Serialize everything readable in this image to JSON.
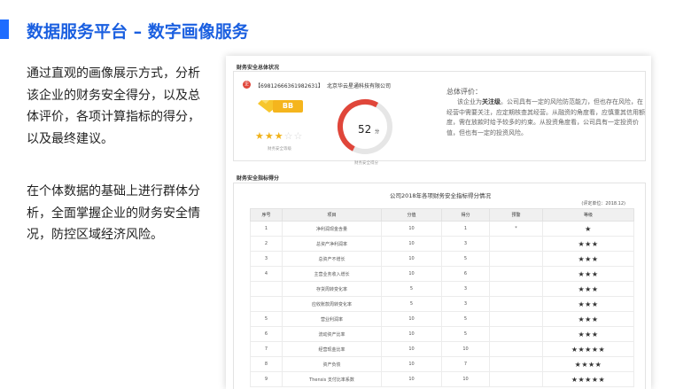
{
  "slide": {
    "title": "数据服务平台 – 数字画像服务",
    "paragraph1": "通过直观的画像展示方式，分析该企业的财务安全得分，以及总体评价，各项计算指标的得分，以及最终建议。",
    "paragraph2": "在个体数据的基础上进行群体分析，全面掌握企业的财务安全情况，防控区域经济风险。"
  },
  "card": {
    "summary_section_title": "财务安全总体状况",
    "company_id": "【69812666361982631】",
    "company_name": "北京华云星通科技有限公司",
    "grade": "BB",
    "stars_on": "★★★",
    "stars_off": "☆☆",
    "rating_caption": "财务安全等级",
    "score": "52",
    "score_unit": "分",
    "score_caption": "财务安全得分",
    "score_fraction": 0.52,
    "eval_title": "总体评价：",
    "eval_prefix": "该企业为",
    "eval_highlight": "关注级",
    "eval_rest": "。公司具有一定的风险防范能力，但也存在风险，在经营中需要关注，应定期核查其经营。从融资的角度看，应慎重其信用额度，需在放款时给予较多的约束。从投资角度看，公司具有一定投资价值，但也有一定的投资风险。",
    "table_section_title": "财务安全指标得分",
    "table_title": "公司2018年各项财务安全指标得分情况",
    "table_unit": "(评定单位：2018.12)",
    "columns": [
      "序号",
      "项目",
      "分值",
      "得分",
      "预警",
      "等级"
    ],
    "rows": [
      {
        "no": "1",
        "item": "净利润现金含量",
        "value": "10",
        "score": "1",
        "warn": "*",
        "level": "★"
      },
      {
        "no": "2",
        "item": "总资产净利润率",
        "value": "10",
        "score": "3",
        "warn": "",
        "level": "★★★"
      },
      {
        "no": "3",
        "item": "总资产不增长",
        "value": "10",
        "score": "5",
        "warn": "",
        "level": "★★★"
      },
      {
        "no": "4",
        "item": "主营业务收入增长",
        "value": "10",
        "score": "6",
        "warn": "",
        "level": "★★★"
      },
      {
        "no": "",
        "item": "存货周转变化率",
        "value": "5",
        "score": "3",
        "warn": "",
        "level": "★★★"
      },
      {
        "no": "",
        "item": "应收账款周转变化率",
        "value": "5",
        "score": "3",
        "warn": "",
        "level": "★★★"
      },
      {
        "no": "5",
        "item": "营业利润率",
        "value": "10",
        "score": "5",
        "warn": "",
        "level": "★★★"
      },
      {
        "no": "6",
        "item": "流动资产比率",
        "value": "10",
        "score": "5",
        "warn": "",
        "level": "★★★"
      },
      {
        "no": "7",
        "item": "经营现金比率",
        "value": "10",
        "score": "10",
        "warn": "",
        "level": "★★★★★"
      },
      {
        "no": "8",
        "item": "资产负债",
        "value": "10",
        "score": "7",
        "warn": "",
        "level": "★★★★"
      },
      {
        "no": "9",
        "item": "Thensis 支付比率系数",
        "value": "10",
        "score": "10",
        "warn": "",
        "level": "★★★★★"
      }
    ]
  },
  "colors": {
    "accent": "#1e6cff",
    "grade_gold": "#f5b51d",
    "gauge_red": "#e0463a",
    "gauge_orange": "#f5a524",
    "gauge_track": "#e6e6e6"
  }
}
